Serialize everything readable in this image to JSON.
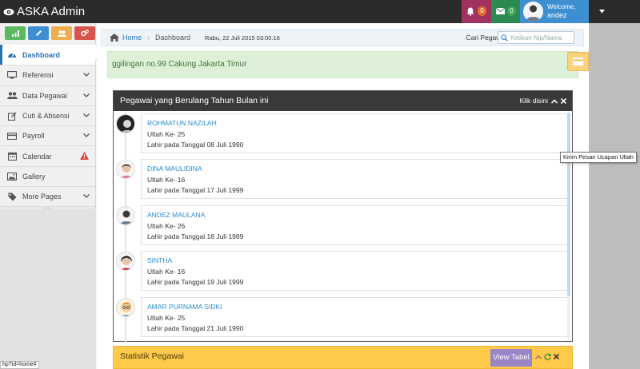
{
  "app": {
    "title": "ASKA Admin"
  },
  "topbar": {
    "notifications_count": "0",
    "messages_count": "0",
    "welcome_label": "Welcome,",
    "username": "andez",
    "colors": {
      "bell": "#a0325f",
      "mail": "#2b8a4f",
      "user": "#3d8fd1"
    }
  },
  "sidebar": {
    "shortcuts": [
      {
        "icon": "bar-chart-icon",
        "color": "#5cb85c"
      },
      {
        "icon": "pencil-icon",
        "color": "#3d8fd1"
      },
      {
        "icon": "users-icon",
        "color": "#f0ad4e"
      },
      {
        "icon": "cogs-icon",
        "color": "#d9534f"
      }
    ],
    "items": [
      {
        "label": "Dashboard",
        "icon": "dashboard-icon"
      },
      {
        "label": "Referensi",
        "icon": "desktop-icon"
      },
      {
        "label": "Data Pegawai",
        "icon": "users-icon"
      },
      {
        "label": "Cuti & Absensi",
        "icon": "edit-icon"
      },
      {
        "label": "Payroll",
        "icon": "credit-card-icon"
      },
      {
        "label": "Calendar",
        "icon": "calendar-icon"
      },
      {
        "label": "Gallery",
        "icon": "picture-icon"
      },
      {
        "label": "More Pages",
        "icon": "tag-icon"
      }
    ]
  },
  "breadcrumb": {
    "home": "Home",
    "current": "Dashboard",
    "datetime": "Rabu, 22 Juli 2015 03:00:16",
    "search_label": "Cari Pegawai",
    "search_placeholder": "Ketikan Nip/Nama"
  },
  "alert": {
    "text": "ggilingan no.99 Cakung Jakarta Timur"
  },
  "birthday_panel": {
    "title": "Pegawai yang Berulang Tahun Bulan ini",
    "action_label": "Klik disini",
    "entries": [
      {
        "name": "ROHMATUN NAZILAH",
        "age": "Ultah Ke- 25",
        "born": "Lahir pada Tanggal 08 Juli 1990"
      },
      {
        "name": "DINA MAULIDINA",
        "age": "Ultah Ke- 16",
        "born": "Lahir pada Tanggal 17 Juli 1999"
      },
      {
        "name": "ANDEZ MAULANA",
        "age": "Ultah Ke- 26",
        "born": "Lahir pada Tanggal 18 Juli 1989"
      },
      {
        "name": "SINTHA",
        "age": "Ultah Ke- 16",
        "born": "Lahir pada Tanggal 19 Juli 1999"
      },
      {
        "name": "AMAR PURNAMA SIDKI",
        "age": "Ultah Ke- 25",
        "born": "Lahir pada Tanggal 21 Juli 1990"
      }
    ]
  },
  "tooltip": {
    "text": "Kirim Pesan Ucapan Ultah"
  },
  "stats_panel": {
    "title": "Statistik Pegawai",
    "view_table": "View Tabel"
  },
  "status_bar": {
    "text": "hp?id=home#"
  }
}
